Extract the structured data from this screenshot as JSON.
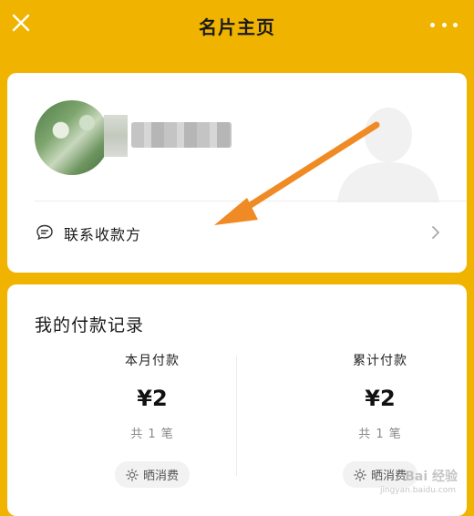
{
  "header": {
    "title": "名片主页",
    "close_icon": "close-icon",
    "more_icon": "more-icon"
  },
  "profile": {
    "contact_label": "联系收款方"
  },
  "payments": {
    "title": "我的付款记录",
    "month": {
      "label": "本月付款",
      "amount": "¥2",
      "count": "共 1 笔",
      "share_label": "晒消费"
    },
    "total": {
      "label": "累计付款",
      "amount": "¥2",
      "count": "共 1 笔",
      "share_label": "晒消费"
    }
  },
  "watermark": {
    "text": "Bai 经验",
    "sub": "jingyan.baidu.com"
  },
  "colors": {
    "background": "#f0b300",
    "annotation_arrow": "#f08a24"
  }
}
